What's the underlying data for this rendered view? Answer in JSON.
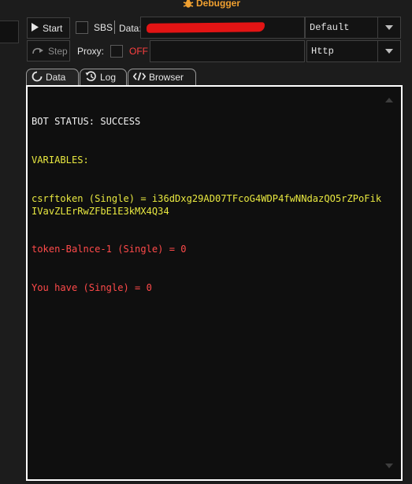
{
  "window": {
    "title": "Debugger"
  },
  "toolbar": {
    "start_label": "Start",
    "step_label": "Step",
    "sbs_label": "SBS",
    "data_label": "Data:",
    "proxy_label": "Proxy:",
    "proxy_state": "OFF",
    "config_select": "Default",
    "proxy_type_select": "Http"
  },
  "tabs": [
    {
      "label": "Data"
    },
    {
      "label": "Log"
    },
    {
      "label": "Browser"
    }
  ],
  "console": {
    "lines": [
      {
        "text": "BOT STATUS: SUCCESS",
        "color": "#f2f2f2"
      },
      {
        "text": "VARIABLES:",
        "color": "#e8e840"
      },
      {
        "text": "csrftoken (Single) = i36dDxg29AD07TFcoG4WDP4fwNNdazQO5rZPoFikIVavZLErRwZFbE1E3kMX4Q34",
        "color": "#e8e840"
      },
      {
        "text": "token-Balnce-1 (Single) = 0",
        "color": "#ff4a4a"
      },
      {
        "text": "You have (Single) = 0",
        "color": "#ff4a4a"
      }
    ]
  },
  "colors": {
    "accent": "#f0a030",
    "proxy_off": "#ff4040",
    "status_success": "#f2f2f2",
    "variable": "#e8e840",
    "variable_missing": "#ff4a4a",
    "panel_border": "#ffffff"
  },
  "icons": {
    "title": "bug-icon",
    "start": "play-icon",
    "step": "step-arrow-icon",
    "data_tab": "refresh-circle-icon",
    "log_tab": "history-icon",
    "browser_tab": "code-icon"
  }
}
